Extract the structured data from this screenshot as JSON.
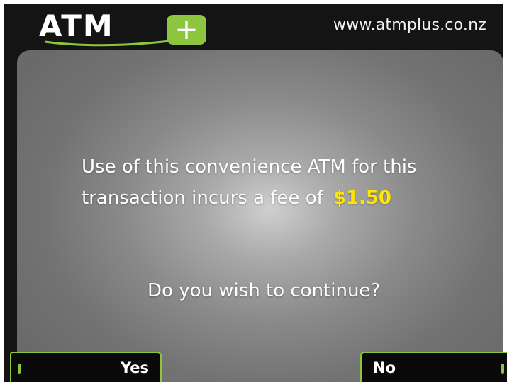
{
  "header": {
    "logo_text": "ATM",
    "logo_plus": "+",
    "url": "www.atmplus.co.nz"
  },
  "main": {
    "message_line1": "Use of this convenience ATM for this",
    "message_line2": "transaction incurs a fee of",
    "fee": "$1.50",
    "question": "Do you wish to continue?"
  },
  "softkeys": {
    "yes_label": "Yes",
    "no_label": "No"
  },
  "colors": {
    "accent_green": "#8cc63f",
    "fee_yellow": "#ffe600",
    "bezel": "#141414"
  }
}
